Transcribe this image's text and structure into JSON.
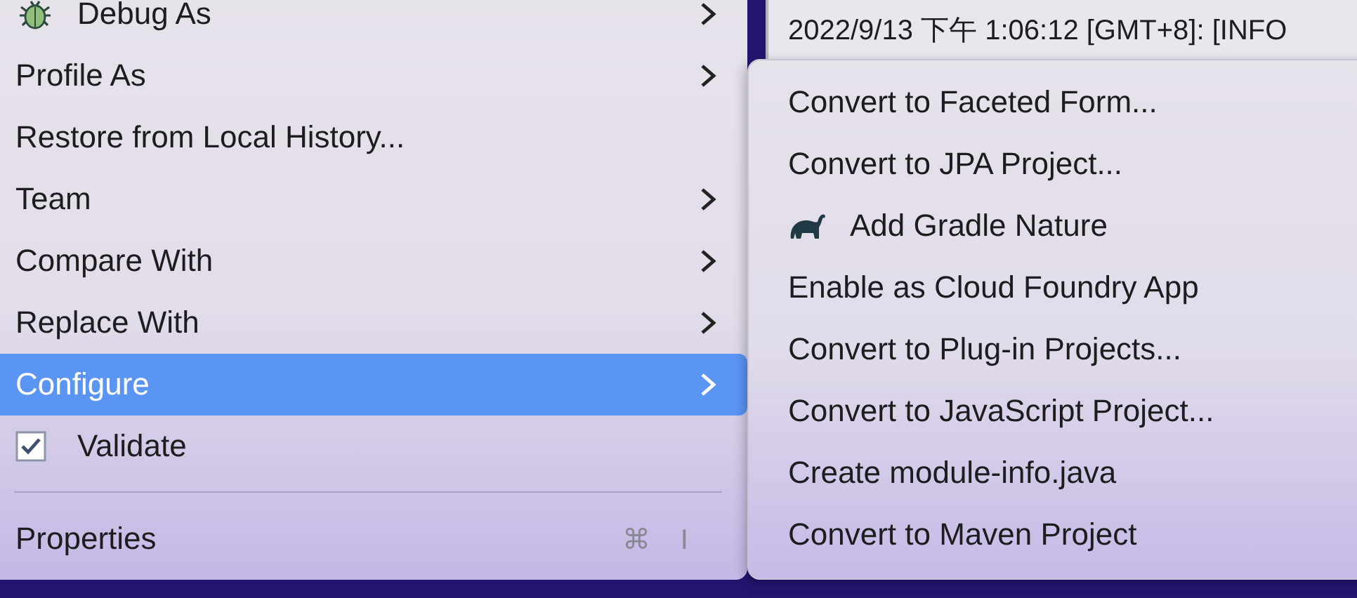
{
  "console": {
    "lines": [
      "2022/9/13 下午 1:06:12 [GMT+8]: [INFO"
    ]
  },
  "context_menu": {
    "items": [
      {
        "kind": "item",
        "label": "Debug As",
        "submenu": true,
        "selected": false
      },
      {
        "kind": "item",
        "label": "Profile As",
        "submenu": true,
        "selected": false
      },
      {
        "kind": "item",
        "label": "Restore from Local History...",
        "submenu": false,
        "selected": false
      },
      {
        "kind": "item",
        "label": "Team",
        "submenu": true,
        "selected": false
      },
      {
        "kind": "item",
        "label": "Compare With",
        "submenu": true,
        "selected": false
      },
      {
        "kind": "item",
        "label": "Replace With",
        "submenu": true,
        "selected": false
      },
      {
        "kind": "item",
        "label": "Configure",
        "submenu": true,
        "selected": true
      },
      {
        "kind": "checkbox",
        "label": "Validate",
        "checked": true
      },
      {
        "kind": "separator"
      },
      {
        "kind": "item",
        "label": "Properties",
        "shortcut": "⌘ I",
        "submenu": false,
        "selected": false
      }
    ]
  },
  "submenu": {
    "items": [
      {
        "label": "Convert to Faceted Form..."
      },
      {
        "label": "Convert to JPA Project..."
      },
      {
        "label": "Add Gradle Nature"
      },
      {
        "label": "Enable as Cloud Foundry App"
      },
      {
        "label": "Convert to Plug-in Projects..."
      },
      {
        "label": "Convert to JavaScript Project..."
      },
      {
        "label": "Create module-info.java"
      },
      {
        "label": "Convert to Maven Project"
      }
    ]
  }
}
